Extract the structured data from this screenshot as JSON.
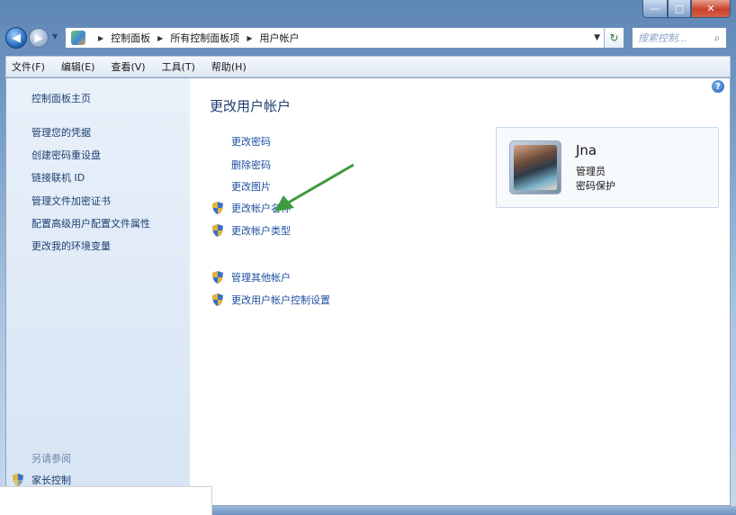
{
  "window": {
    "caption": {
      "minimize": "—",
      "maximize": "□",
      "close": "✕"
    }
  },
  "nav": {
    "back": "◀",
    "forward": "▶",
    "history": "▼",
    "breadcrumbs": [
      "控制面板",
      "所有控制面板项",
      "用户帐户"
    ],
    "separator": "▶",
    "dropdown": "▼",
    "refresh": "↻",
    "search_placeholder": "搜索控制...",
    "search_icon": "⌕"
  },
  "menu": [
    "文件(F)",
    "编辑(E)",
    "查看(V)",
    "工具(T)",
    "帮助(H)"
  ],
  "sidebar": {
    "links": [
      "控制面板主页",
      "管理您的凭据",
      "创建密码重设盘",
      "链接联机 ID",
      "管理文件加密证书",
      "配置高级用户配置文件属性",
      "更改我的环境变量"
    ],
    "see_also_heading": "另请参阅",
    "see_also_item": "家长控制"
  },
  "main": {
    "title": "更改用户帐户",
    "tasks": [
      "更改密码",
      "删除密码",
      "更改图片"
    ],
    "shield_tasks": [
      "更改帐户名称",
      "更改帐户类型"
    ],
    "other_tasks": [
      "管理其他帐户",
      "更改用户帐户控制设置"
    ],
    "help": "?"
  },
  "account": {
    "name": "Jna",
    "role": "管理员",
    "protection": "密码保护"
  },
  "colors": {
    "link": "#1e4fa0",
    "text": "#1e3f70",
    "arrow": "#3f9a3f"
  }
}
